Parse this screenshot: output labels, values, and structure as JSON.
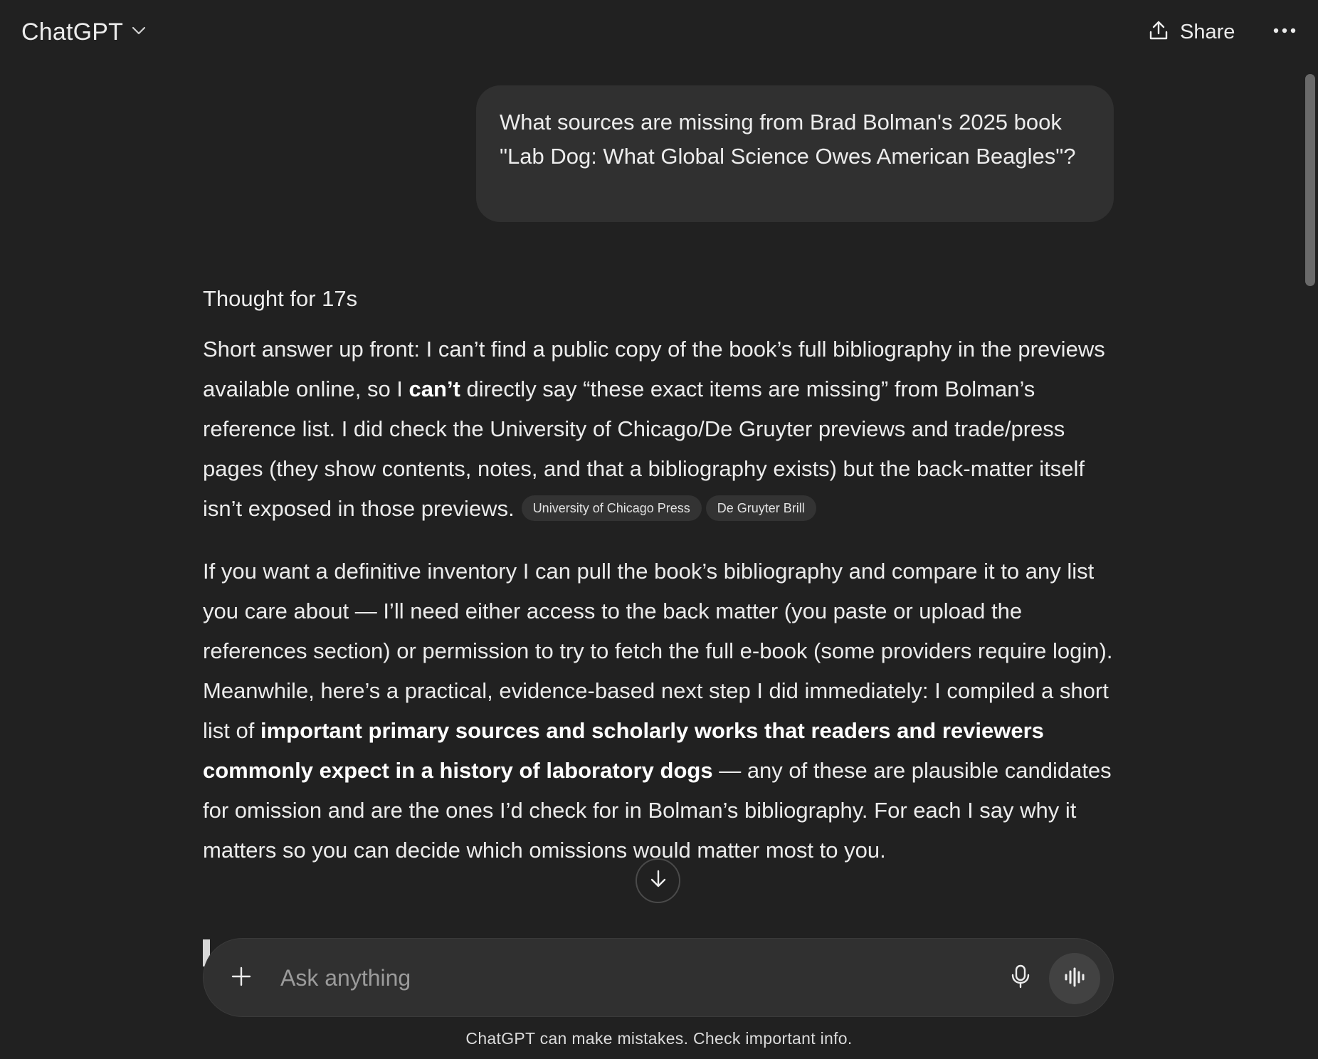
{
  "header": {
    "model_name": "ChatGPT",
    "share_label": "Share"
  },
  "user_message": {
    "text": "What sources are missing from Brad Bolman's 2025 book \"Lab Dog: What Global Science Owes American Beagles\"?"
  },
  "assistant": {
    "thought_label": "Thought for 17s",
    "paragraph1": {
      "part1": "Short answer up front: I can’t find a public copy of the book’s full bibliography in the previews available online, so I ",
      "bold1": "can’t",
      "part2": " directly say “these exact items are missing” from Bolman’s reference list. I did check the University of Chicago/De Gruyter previews and trade/press pages (they show contents, notes, and that a bibliography exists) but the back-matter itself isn’t exposed in those previews.",
      "citations": [
        "University of Chicago Press",
        "De Gruyter Brill"
      ]
    },
    "paragraph2": {
      "part1": "If you want a definitive inventory I can pull the book’s bibliography and compare it to any list you care about — I’ll need either access to the back matter (you paste or upload the references section) or permission to try to fetch the full e-book (some providers require login). Meanwhile, here’s a practical, evidence-based next step I did immediately: I compiled a short list of ",
      "bold1": "important primary sources and scholarly works that readers and reviewers commonly expect in a history of laboratory dogs",
      "part2": " — any of these are plausible candidates for omission and are the ones I’d check for in Bolman’s bibliography. For each I say why it matters so you can decide which omissions would matter most to you."
    }
  },
  "composer": {
    "placeholder": "Ask anything"
  },
  "footer": {
    "disclaimer": "ChatGPT can make mistakes. Check important info."
  },
  "icons": {
    "model_switcher": "chevron-down-icon",
    "share": "share-upload-icon",
    "more": "more-horizontal-icon",
    "scroll_down": "arrow-down-icon",
    "plus": "plus-icon",
    "mic": "microphone-icon",
    "voice": "voice-waveform-icon"
  },
  "colors": {
    "background": "#212121",
    "bubble": "#303030",
    "text": "#ececec",
    "citation_pill": "#333333"
  }
}
